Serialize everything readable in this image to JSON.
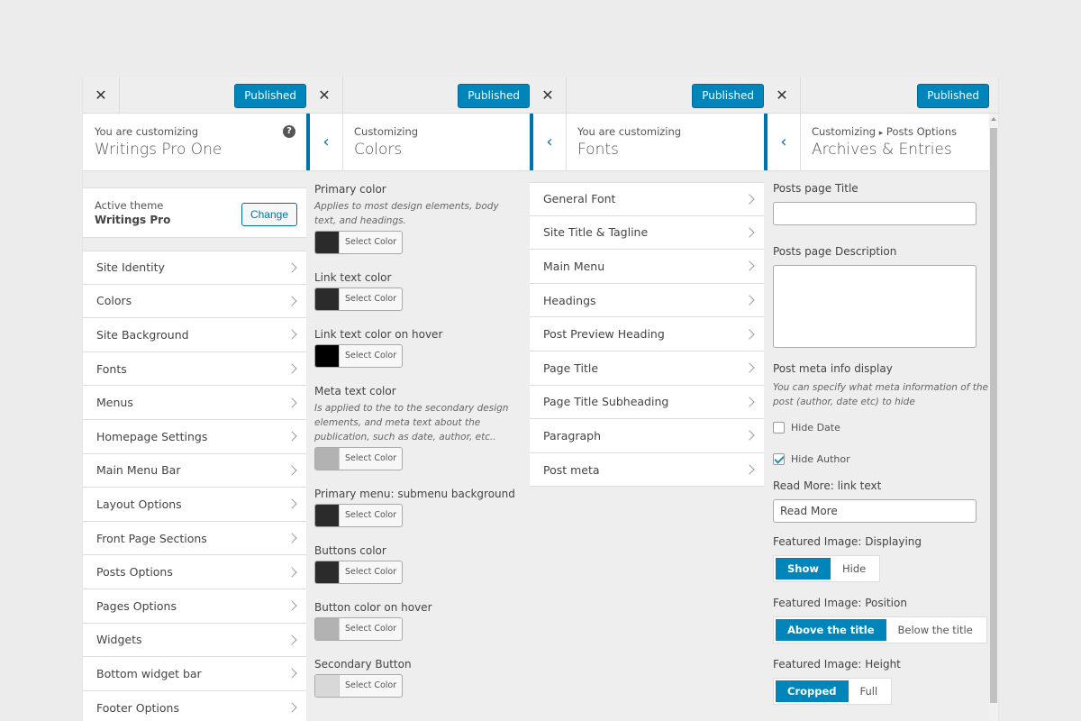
{
  "common": {
    "publish_label": "Published"
  },
  "panel1": {
    "customizing_label": "You are customizing",
    "site_name": "Writings Pro One",
    "active_theme_label": "Active theme",
    "theme_name": "Writings Pro",
    "change_label": "Change",
    "items": [
      {
        "label": "Site Identity"
      },
      {
        "label": "Colors"
      },
      {
        "label": "Site Background"
      },
      {
        "label": "Fonts"
      },
      {
        "label": "Menus"
      },
      {
        "label": "Homepage Settings"
      },
      {
        "label": "Main Menu Bar"
      },
      {
        "label": "Layout Options"
      },
      {
        "label": "Front Page Sections"
      },
      {
        "label": "Posts Options"
      },
      {
        "label": "Pages Options"
      },
      {
        "label": "Widgets"
      },
      {
        "label": "Bottom widget bar"
      },
      {
        "label": "Footer Options"
      }
    ]
  },
  "panel2": {
    "breadcrumb": "Customizing",
    "title": "Colors",
    "select_color_label": "Select Color",
    "controls": [
      {
        "title": "Primary color",
        "desc": "Applies to most design elements, body text, and headings.",
        "color": "#2b2b2b"
      },
      {
        "title": "Link text color",
        "desc": "",
        "color": "#2b2b2b"
      },
      {
        "title": "Link text color on hover",
        "desc": "",
        "color": "#000000"
      },
      {
        "title": "Meta text color",
        "desc": "Is applied to the to the secondary design elements, and meta text about the publication, such as date, author, etc..",
        "color": "#b2b2b2"
      },
      {
        "title": "Primary menu: submenu background",
        "desc": "",
        "color": "#2b2b2b"
      },
      {
        "title": "Buttons color",
        "desc": "",
        "color": "#2b2b2b"
      },
      {
        "title": "Button color on hover",
        "desc": "",
        "color": "#b2b2b2"
      },
      {
        "title": "Secondary Button",
        "desc": "",
        "color": "#d8d8d8"
      }
    ]
  },
  "panel3": {
    "customizing_label": "You are customizing",
    "title": "Fonts",
    "items": [
      {
        "label": "General Font"
      },
      {
        "label": "Site Title & Tagline"
      },
      {
        "label": "Main Menu"
      },
      {
        "label": "Headings"
      },
      {
        "label": "Post Preview Heading"
      },
      {
        "label": "Page Title"
      },
      {
        "label": "Page Title Subheading"
      },
      {
        "label": "Paragraph"
      },
      {
        "label": "Post meta"
      }
    ]
  },
  "panel4": {
    "breadcrumb_root": "Customizing",
    "breadcrumb_sep": "▸",
    "breadcrumb_parent": "Posts Options",
    "title": "Archives & Entries",
    "posts_page_title_label": "Posts page Title",
    "posts_page_title_value": "",
    "posts_page_desc_label": "Posts page Description",
    "meta_display_label": "Post meta info display",
    "meta_display_desc": "You can specify what meta information of the post (author, date etc) to hide",
    "hide_date_label": "Hide Date",
    "hide_date_checked": false,
    "hide_author_label": "Hide Author",
    "hide_author_checked": true,
    "read_more_label": "Read More: link text",
    "read_more_value": "Read More",
    "featured_display_label": "Featured Image: Displaying",
    "featured_display_options": [
      "Show",
      "Hide"
    ],
    "featured_display_selected": "Show",
    "featured_position_label": "Featured Image: Position",
    "featured_position_options": [
      "Above the title",
      "Below the title"
    ],
    "featured_position_selected": "Above the title",
    "featured_height_label": "Featured Image: Height",
    "featured_height_options": [
      "Cropped",
      "Full"
    ],
    "featured_height_selected": "Cropped"
  }
}
